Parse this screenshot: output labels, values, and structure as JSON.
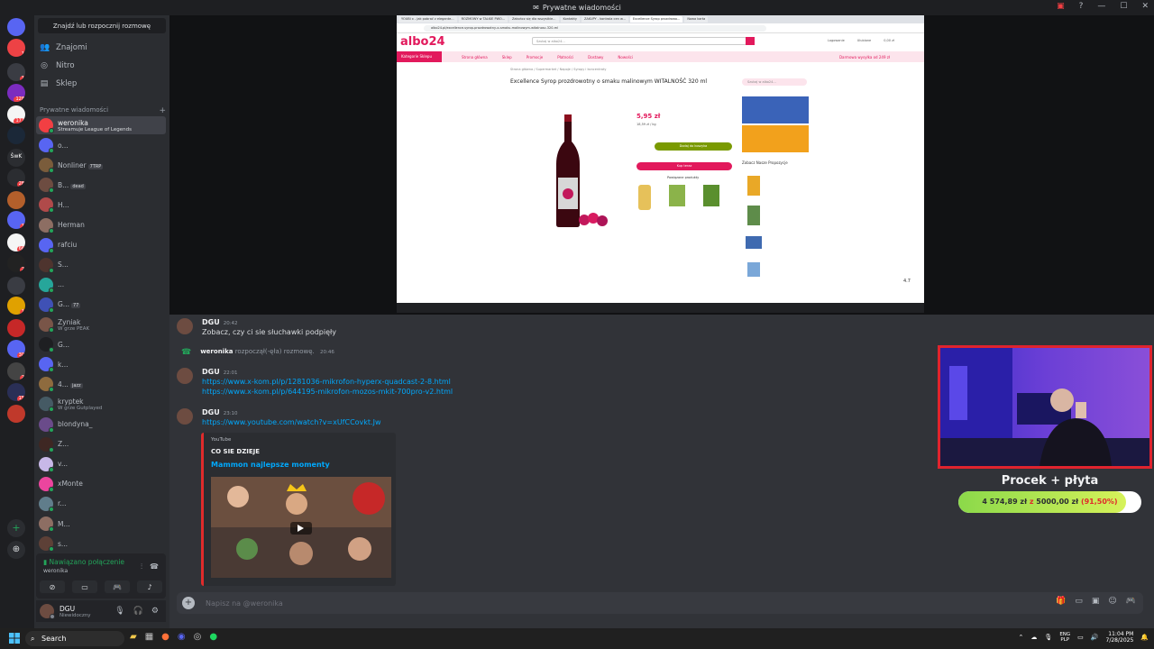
{
  "window": {
    "title": "Prywatne wiadomości"
  },
  "sidebar": {
    "find_button": "Znajdź lub rozpocznij rozmowę",
    "nav": [
      {
        "label": "Znajomi",
        "icon": "friends-icon"
      },
      {
        "label": "Nitro",
        "icon": "nitro-icon"
      },
      {
        "label": "Sklep",
        "icon": "shop-icon"
      }
    ],
    "dm_header": "Prywatne wiadomości",
    "dm_add": "+",
    "dms": [
      {
        "name": "weronika",
        "sub": "Streamuje League of Legends",
        "active": true
      },
      {
        "name": "o...",
        "sub": ""
      },
      {
        "name": "Nonliner",
        "tag": "7TRP",
        "sub": ""
      },
      {
        "name": "B...",
        "tag": "dead",
        "sub": ""
      },
      {
        "name": "H...",
        "sub": ""
      },
      {
        "name": "Herman",
        "sub": ""
      },
      {
        "name": "rafciu",
        "sub": ""
      },
      {
        "name": "S...",
        "sub": ""
      },
      {
        "name": "...",
        "sub": ""
      },
      {
        "name": "G...",
        "tag": "77",
        "sub": ""
      },
      {
        "name": "Zyniak",
        "sub": "W grze PEAK"
      },
      {
        "name": "G...",
        "sub": ""
      },
      {
        "name": "k...",
        "sub": ""
      },
      {
        "name": "4...",
        "tag": "jazz",
        "sub": ""
      },
      {
        "name": "kryptek",
        "sub": "W grze Gutplayed"
      },
      {
        "name": "blondyna_",
        "sub": ""
      },
      {
        "name": "Z...",
        "sub": ""
      },
      {
        "name": "v...",
        "sub": ""
      },
      {
        "name": "xMonte",
        "sub": ""
      },
      {
        "name": "r...",
        "sub": ""
      },
      {
        "name": "M...",
        "sub": ""
      },
      {
        "name": "s...",
        "sub": ""
      }
    ],
    "voice": {
      "status": "Nawiązano połączenie",
      "channel": "weronika"
    },
    "user": {
      "name": "DGU",
      "status": "Niewidoczny"
    }
  },
  "rail": {
    "servers": [
      {
        "label": "",
        "badge": ""
      },
      {
        "label": "",
        "badge": "1"
      },
      {
        "label": "",
        "badge": "1"
      },
      {
        "label": "",
        "badge": "128"
      },
      {
        "label": "",
        "badge": "177"
      },
      {
        "label": "",
        "badge": ""
      },
      {
        "label": "ŚwK",
        "badge": ""
      },
      {
        "label": "",
        "badge": "28"
      },
      {
        "label": "",
        "badge": ""
      },
      {
        "label": "",
        "badge": "1"
      },
      {
        "label": "",
        "badge": "66"
      },
      {
        "label": "",
        "badge": "2"
      },
      {
        "label": "",
        "badge": ""
      },
      {
        "label": "",
        "badge": "1"
      },
      {
        "label": "",
        "badge": ""
      },
      {
        "label": "",
        "badge": "30"
      },
      {
        "label": "",
        "badge": "2"
      },
      {
        "label": "",
        "badge": "15"
      },
      {
        "label": "",
        "badge": ""
      }
    ]
  },
  "stream": {
    "tabs": [
      "YOUBI x - Jak pobrać z elegante...",
      "ROZMOWY w TALKIE PWO...",
      "Zakończ się dla wszystkie...",
      "Kontakty",
      "ZAKUPY - kontrola cen w...",
      "Excellence Syrop prozdrowo...",
      "Nowa karta"
    ],
    "url": "albo24.pl/excellence-syrop-prozdrowotny-o-smaku-malinowym-witalnosc-320-ml",
    "logo": "albo24",
    "search_placeholder": "Szukaj w albo24...",
    "header_links": [
      "Logowanie",
      "Ulubione",
      "0,00 zł"
    ],
    "nav_category": "Kategorie Sklepu",
    "nav_items": [
      "Strona główna",
      "Sklep",
      "Promocje",
      "Płatności",
      "Dostawy",
      "Nowości"
    ],
    "delivery": "Darmowa wysyłka od 249 zł",
    "breadcrumb": "Strona główna / Supermarket / Napoje / Syropy i koncentraty",
    "product_title": "Excellence Syrop prozdrowotny o smaku malinowym WITALNOŚĆ 320 ml",
    "price": "5,95 zł",
    "price_unit": "18,59 zł / kg",
    "cart_button": "Dodaj do koszyka",
    "buy_button": "Kup teraz",
    "related_title": "Powiązane produkty",
    "side_search": "Szukaj w albo24...",
    "side_title": "Zobacz Nasze Propozycje",
    "rating": "4.7"
  },
  "chat": {
    "messages": [
      {
        "author": "DGU",
        "time": "20:42",
        "text": "Zobacz, czy ci sie słuchawki podpięły"
      },
      {
        "system": true,
        "author": "weronika",
        "text": "rozpoczął(-ęła) rozmowę.",
        "time": "20:46"
      },
      {
        "author": "DGU",
        "time": "22:01",
        "links": [
          "https://www.x-kom.pl/p/1281036-mikrofon-hyperx-quadcast-2-8.html",
          "https://www.x-kom.pl/p/644195-mikrofon-mozos-mkit-700pro-v2.html"
        ]
      },
      {
        "author": "DGU",
        "time": "23:10",
        "links": [
          "https://www.youtube.com/watch?v=xUfCCovkt.Jw"
        ]
      }
    ],
    "embed": {
      "provider": "YouTube",
      "author": "CO SIE DZIEJE",
      "title": "Mammon najlepsze momenty"
    },
    "input_placeholder": "Napisz na @weronika"
  },
  "overlay": {
    "goal_title": "Procek + płyta",
    "goal_current": "4 574,89 zł",
    "goal_sep": "z",
    "goal_target": "5000,00 zł",
    "goal_percent": "(91,50%)",
    "goal_fraction": 0.915
  },
  "taskbar": {
    "search": "Search",
    "lang": "ENG",
    "lang2": "PLP",
    "time": "11:04 PM",
    "date": "7/28/2025"
  },
  "colors": {
    "accent": "#5865f2",
    "brand": "#e2195c",
    "online": "#23a55a",
    "link": "#00a8fc"
  }
}
